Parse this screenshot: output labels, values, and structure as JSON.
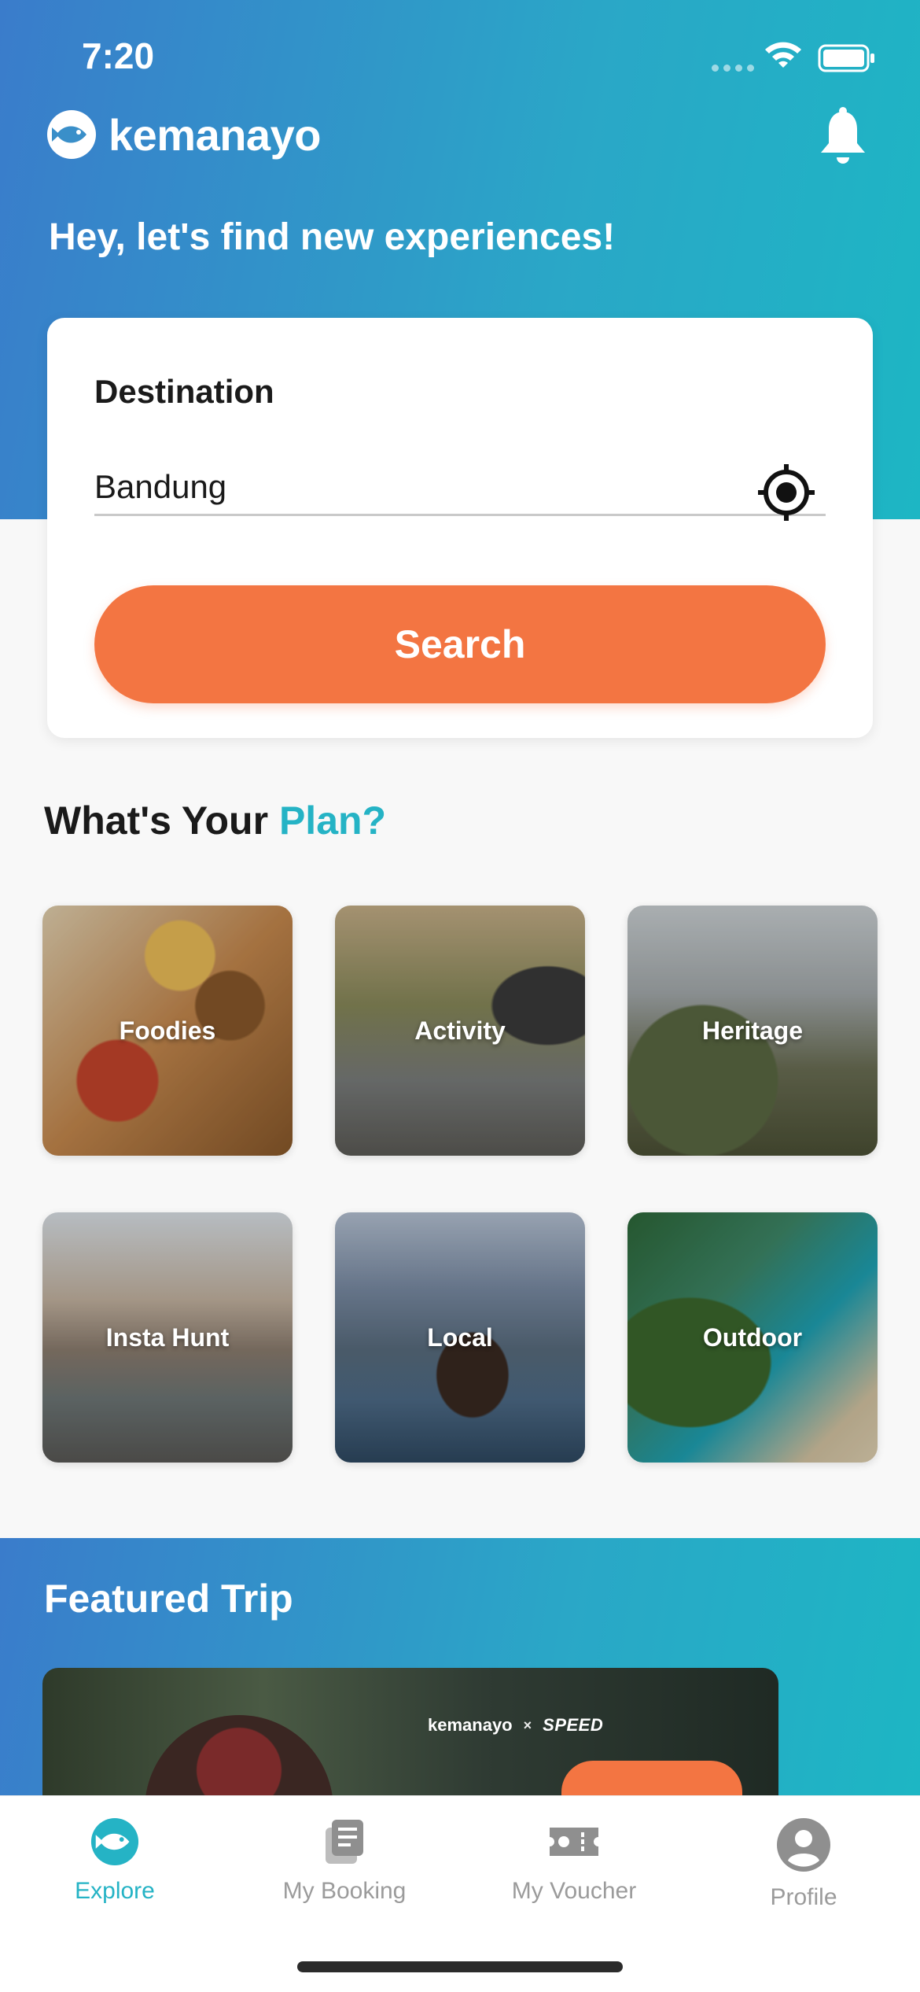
{
  "status_bar": {
    "time": "7:20"
  },
  "app": {
    "brand": "kemanayo",
    "greeting": "Hey, let's find new experiences!"
  },
  "search_card": {
    "label": "Destination",
    "destination_value": "Bandung",
    "search_button": "Search"
  },
  "plan": {
    "title_part1": "What's Your ",
    "title_part2": "Plan?",
    "categories": [
      {
        "label": "Foodies"
      },
      {
        "label": "Activity"
      },
      {
        "label": "Heritage"
      },
      {
        "label": "Insta Hunt"
      },
      {
        "label": "Local"
      },
      {
        "label": "Outdoor"
      }
    ]
  },
  "featured": {
    "title": "Featured Trip",
    "card_brand": "kemanayo",
    "card_partner": "SPEED",
    "card_separator": "×"
  },
  "tabs": [
    {
      "label": "Explore",
      "icon": "fish-logo-icon",
      "active": true
    },
    {
      "label": "My Booking",
      "icon": "booking-document-icon",
      "active": false
    },
    {
      "label": "My Voucher",
      "icon": "ticket-icon",
      "active": false
    },
    {
      "label": "Profile",
      "icon": "profile-icon",
      "active": false
    }
  ],
  "colors": {
    "accent": "#25b3c5",
    "primary_button": "#f37542",
    "header_gradient_start": "#3a7ccb",
    "header_gradient_end": "#1db6c4"
  }
}
